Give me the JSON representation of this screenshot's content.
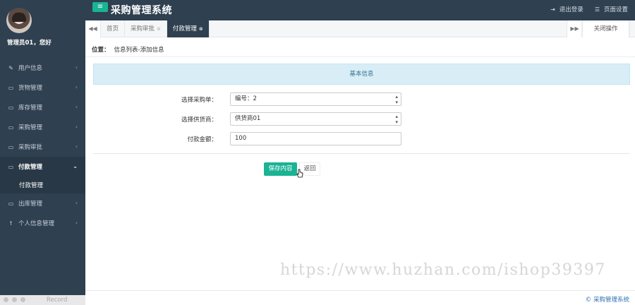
{
  "app": {
    "title": "采购管理系统",
    "menu_toggle_icon": "bars-icon"
  },
  "topbar": {
    "logout_label": "退出登录",
    "logout_icon": "sign-out-icon",
    "settings_label": "页面设置",
    "settings_icon": "sliders-icon"
  },
  "user": {
    "greeting": "管理员01，您好"
  },
  "sidebar": {
    "items": [
      {
        "label": "用户信息",
        "icon": "edit-icon",
        "glyph": "✎"
      },
      {
        "label": "货物管理",
        "icon": "desktop-icon",
        "glyph": "▭"
      },
      {
        "label": "库存管理",
        "icon": "desktop-icon",
        "glyph": "▭"
      },
      {
        "label": "采购管理",
        "icon": "desktop-icon",
        "glyph": "▭"
      },
      {
        "label": "采购审批",
        "icon": "desktop-icon",
        "glyph": "▭"
      },
      {
        "label": "付款管理",
        "icon": "desktop-icon",
        "glyph": "▭",
        "active": true
      },
      {
        "label": "出库管理",
        "icon": "desktop-icon",
        "glyph": "▭"
      },
      {
        "label": "个人信息管理",
        "icon": "cutlery-icon",
        "glyph": "¥"
      }
    ],
    "submenu_label": "付款管理"
  },
  "tabs": {
    "items": [
      {
        "label": "首页"
      },
      {
        "label": "采购审批",
        "closable": true
      },
      {
        "label": "付款管理",
        "closable": true,
        "active": true
      }
    ],
    "close_ops_label": "关闭操作"
  },
  "breadcrumb": {
    "prefix": "位置：",
    "path": "信息列表-添加信息"
  },
  "panel": {
    "heading": "基本信息"
  },
  "form": {
    "purchase_order": {
      "label": "选择采购单：",
      "value": "编号：2"
    },
    "supplier": {
      "label": "选择供货商：",
      "value": "供货商01"
    },
    "amount": {
      "label": "付款金额：",
      "value": "100"
    }
  },
  "buttons": {
    "save": "保存内容",
    "back": "返回"
  },
  "watermark": "https://www.huzhan.com/ishop39397",
  "footer": {
    "text": "© 采购管理系统"
  },
  "recorder": {
    "label": "Record"
  }
}
